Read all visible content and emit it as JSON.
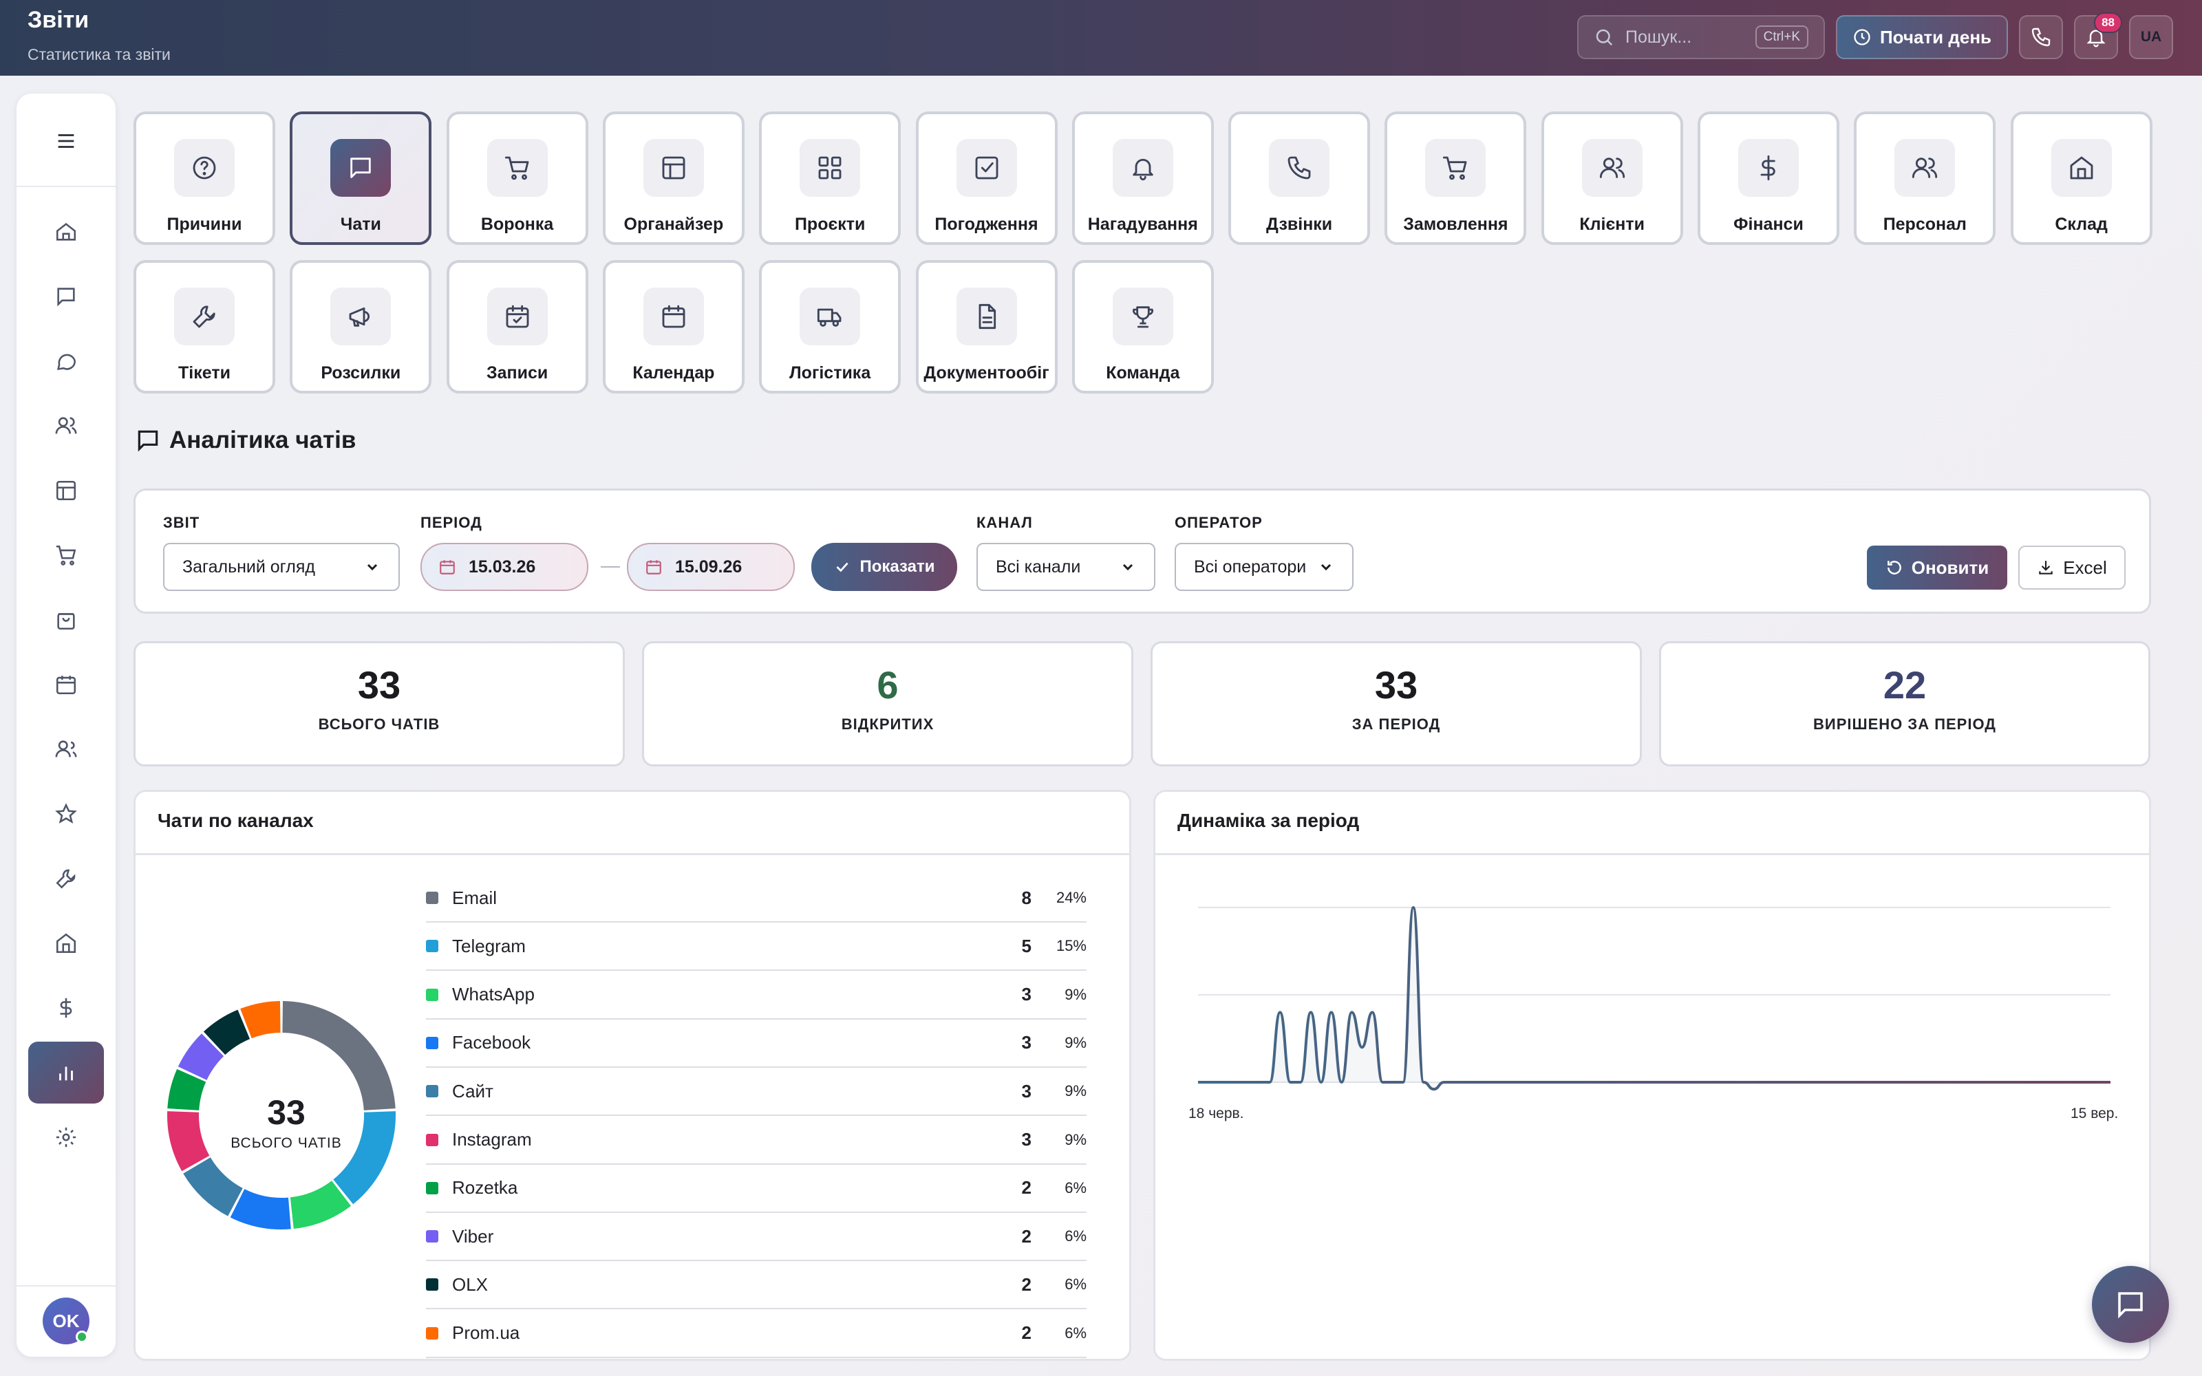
{
  "header": {
    "title": "Звіти",
    "subtitle": "Статистика та звіти",
    "search_placeholder": "Пошук...",
    "search_shortcut": "Ctrl+K",
    "start_day_label": "Почати день",
    "notifications_count": "88",
    "lang": "UA"
  },
  "sidebar": {
    "items": [
      "menu-icon",
      "home-icon",
      "chat-icon",
      "message-circle-icon",
      "users-icon",
      "layout-icon",
      "cart-icon",
      "bag-icon",
      "calendar-icon",
      "team-icon",
      "star-icon",
      "wrench-icon",
      "warehouse-icon",
      "dollar-icon",
      "bar-chart-icon",
      "gear-icon"
    ],
    "active": "bar-chart-icon",
    "avatar_initials": "OK"
  },
  "modules": [
    {
      "label": "Причини",
      "icon": "help-circle-icon"
    },
    {
      "label": "Чати",
      "icon": "chat-icon",
      "active": true
    },
    {
      "label": "Воронка",
      "icon": "cart-icon"
    },
    {
      "label": "Органайзер",
      "icon": "layout-icon"
    },
    {
      "label": "Проєкти",
      "icon": "grid-icon"
    },
    {
      "label": "Погодження",
      "icon": "check-square-icon"
    },
    {
      "label": "Нагадування",
      "icon": "bell-icon"
    },
    {
      "label": "Дзвінки",
      "icon": "phone-icon"
    },
    {
      "label": "Замовлення",
      "icon": "cart-icon"
    },
    {
      "label": "Клієнти",
      "icon": "users-icon"
    },
    {
      "label": "Фінанси",
      "icon": "dollar-icon"
    },
    {
      "label": "Персонал",
      "icon": "users-icon"
    },
    {
      "label": "Склад",
      "icon": "warehouse-icon"
    },
    {
      "label": "Тікети",
      "icon": "wrench-icon"
    },
    {
      "label": "Розсилки",
      "icon": "megaphone-icon"
    },
    {
      "label": "Записи",
      "icon": "calendar-check-icon"
    },
    {
      "label": "Календар",
      "icon": "calendar-icon"
    },
    {
      "label": "Логістика",
      "icon": "truck-icon"
    },
    {
      "label": "Документообіг",
      "icon": "document-icon"
    },
    {
      "label": "Команда",
      "icon": "trophy-icon"
    }
  ],
  "section_title": "Аналітика чатів",
  "filters": {
    "report_label": "ЗВІТ",
    "report_value": "Загальний огляд",
    "period_label": "ПЕРІОД",
    "date_from": "15.03.26",
    "date_to": "15.09.26",
    "show_label": "Показати",
    "channel_label": "КАНАЛ",
    "channel_value": "Всі канали",
    "operator_label": "ОПЕРАТОР",
    "operator_value": "Всі оператори",
    "refresh_label": "Оновити",
    "excel_label": "Excel"
  },
  "stats": [
    {
      "value": "33",
      "caption": "ВСЬОГО ЧАТІВ",
      "color": "#1a1a1f"
    },
    {
      "value": "6",
      "caption": "ВІДКРИТИХ",
      "color": "#2e6b47"
    },
    {
      "value": "33",
      "caption": "ЗА ПЕРІОД",
      "color": "#1a1a1f"
    },
    {
      "value": "22",
      "caption": "ВИРІШЕНО ЗА ПЕРІОД",
      "color": "#3e4470"
    }
  ],
  "channels_card": {
    "title": "Чати по каналах",
    "center_value": "33",
    "center_caption": "ВСЬОГО ЧАТІВ",
    "rows": [
      {
        "name": "Email",
        "count": "8",
        "pct": "24%",
        "color": "#6b7280"
      },
      {
        "name": "Telegram",
        "count": "5",
        "pct": "15%",
        "color": "#229ed9"
      },
      {
        "name": "WhatsApp",
        "count": "3",
        "pct": "9%",
        "color": "#25d366"
      },
      {
        "name": "Facebook",
        "count": "3",
        "pct": "9%",
        "color": "#1877f2"
      },
      {
        "name": "Сайт",
        "count": "3",
        "pct": "9%",
        "color": "#3b7ea8"
      },
      {
        "name": "Instagram",
        "count": "3",
        "pct": "9%",
        "color": "#e1306c"
      },
      {
        "name": "Rozetka",
        "count": "2",
        "pct": "6%",
        "color": "#00a046"
      },
      {
        "name": "Viber",
        "count": "2",
        "pct": "6%",
        "color": "#7360f2"
      },
      {
        "name": "OLX",
        "count": "2",
        "pct": "6%",
        "color": "#002f34"
      },
      {
        "name": "Prom.ua",
        "count": "2",
        "pct": "6%",
        "color": "#ff6a00"
      }
    ]
  },
  "dynamics_card": {
    "title": "Динаміка за період",
    "x_start_label": "18 черв.",
    "x_end_label": "15 вер."
  },
  "chart_data": [
    {
      "type": "pie",
      "title": "Чати по каналах",
      "categories": [
        "Email",
        "Telegram",
        "WhatsApp",
        "Facebook",
        "Сайт",
        "Instagram",
        "Rozetka",
        "Viber",
        "OLX",
        "Prom.ua"
      ],
      "values": [
        8,
        5,
        3,
        3,
        3,
        3,
        2,
        2,
        2,
        2
      ],
      "colors": [
        "#6b7280",
        "#229ed9",
        "#25d366",
        "#1877f2",
        "#3b7ea8",
        "#e1306c",
        "#00a046",
        "#7360f2",
        "#002f34",
        "#ff6a00"
      ]
    },
    {
      "type": "line",
      "title": "Динаміка за період",
      "x_start": "18 черв.",
      "x_end": "15 вер.",
      "grid": true,
      "values": [
        0,
        0,
        0,
        0,
        0,
        0,
        0,
        0,
        2,
        0,
        0,
        2,
        0,
        2,
        0,
        2,
        1,
        2,
        0,
        0,
        0,
        5,
        0,
        -0.2,
        0,
        0,
        0,
        0,
        0,
        0,
        0,
        0,
        0,
        0,
        0,
        0,
        0,
        0,
        0,
        0,
        0,
        0,
        0,
        0,
        0,
        0,
        0,
        0,
        0,
        0,
        0,
        0,
        0,
        0,
        0,
        0,
        0,
        0,
        0,
        0,
        0,
        0,
        0,
        0,
        0,
        0,
        0,
        0,
        0,
        0,
        0,
        0,
        0,
        0,
        0,
        0,
        0,
        0,
        0,
        0,
        0,
        0,
        0,
        0,
        0,
        0,
        0,
        0,
        0,
        0
      ],
      "ylim": [
        0,
        5
      ]
    }
  ]
}
